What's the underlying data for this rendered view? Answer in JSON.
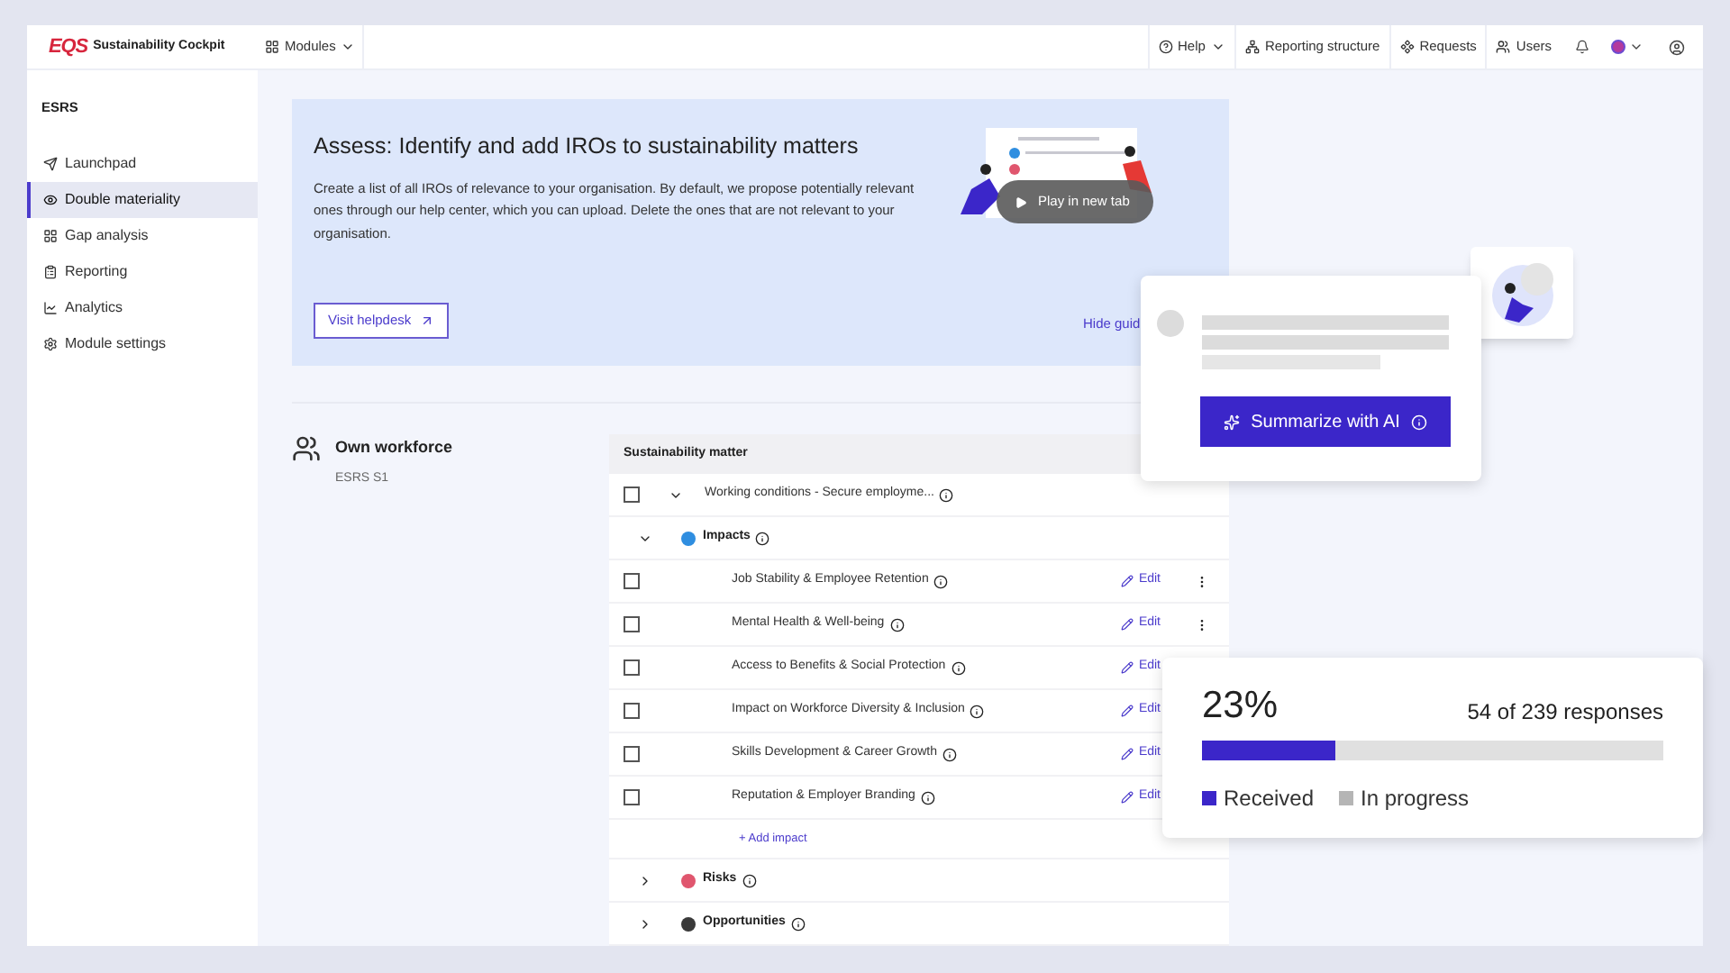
{
  "header": {
    "logo": "EQS",
    "app_name": "Sustainability Cockpit",
    "modules": "Modules",
    "nav": [
      {
        "kind": "help",
        "label": "Help"
      },
      {
        "kind": "structure",
        "label": "Reporting structure"
      },
      {
        "kind": "requests",
        "label": "Requests"
      },
      {
        "kind": "users",
        "label": "Users"
      }
    ]
  },
  "sidebar": {
    "title": "ESRS",
    "items": [
      {
        "label": "Launchpad",
        "selected": false
      },
      {
        "label": "Double materiality",
        "selected": true
      },
      {
        "label": "Gap analysis",
        "selected": false
      },
      {
        "label": "Reporting",
        "selected": false
      },
      {
        "label": "Analytics",
        "selected": false
      },
      {
        "label": "Module settings",
        "selected": false
      }
    ]
  },
  "guide": {
    "title": "Assess: Identify and add IROs to sustainability matters",
    "text": "Create a list of all IROs of relevance to your organisation. By default, we propose potentially relevant ones through our help center, which you can upload. Delete the ones that are not relevant to your organisation.",
    "video_button": "Play in new tab",
    "helpdesk_button": "Visit helpdesk",
    "hide_link": "Hide guid"
  },
  "section": {
    "title": "Own workforce",
    "code": "ESRS S1"
  },
  "table": {
    "header": "Sustainability matter",
    "matter": {
      "label": "Working conditions - Secure employme...",
      "checked": false,
      "expanded": true
    },
    "groups": [
      {
        "label": "Impacts",
        "color": "#2f8ee0",
        "expanded": true,
        "add_label": "+ Add impact",
        "items": [
          {
            "label": "Job Stability & Employee Retention",
            "checked": false,
            "edit": "Edit",
            "menu": true
          },
          {
            "label": "Mental Health & Well-being",
            "checked": false,
            "edit": "Edit",
            "menu": true
          },
          {
            "label": "Access to Benefits & Social Protection",
            "checked": false,
            "edit": "Edit",
            "menu": false
          },
          {
            "label": "Impact on Workforce Diversity & Inclusion",
            "checked": false,
            "edit": "Edit",
            "menu": false
          },
          {
            "label": "Skills Development & Career Growth",
            "checked": false,
            "edit": "Edit",
            "menu": false
          },
          {
            "label": "Reputation & Employer Branding",
            "checked": false,
            "edit": "Edit",
            "menu": false
          }
        ]
      },
      {
        "label": "Risks",
        "color": "#e0566e",
        "expanded": false
      },
      {
        "label": "Opportunities",
        "color": "#3a3a3a",
        "expanded": false
      }
    ]
  },
  "ai_card": {
    "button": "Summarize with AI"
  },
  "progress": {
    "percent": "23%",
    "responses": "54 of 239 responses",
    "level": 0.29,
    "legend": [
      {
        "label": "Received",
        "color": "#3b26c9"
      },
      {
        "label": "In progress",
        "color": "#b5b5b5"
      }
    ]
  }
}
